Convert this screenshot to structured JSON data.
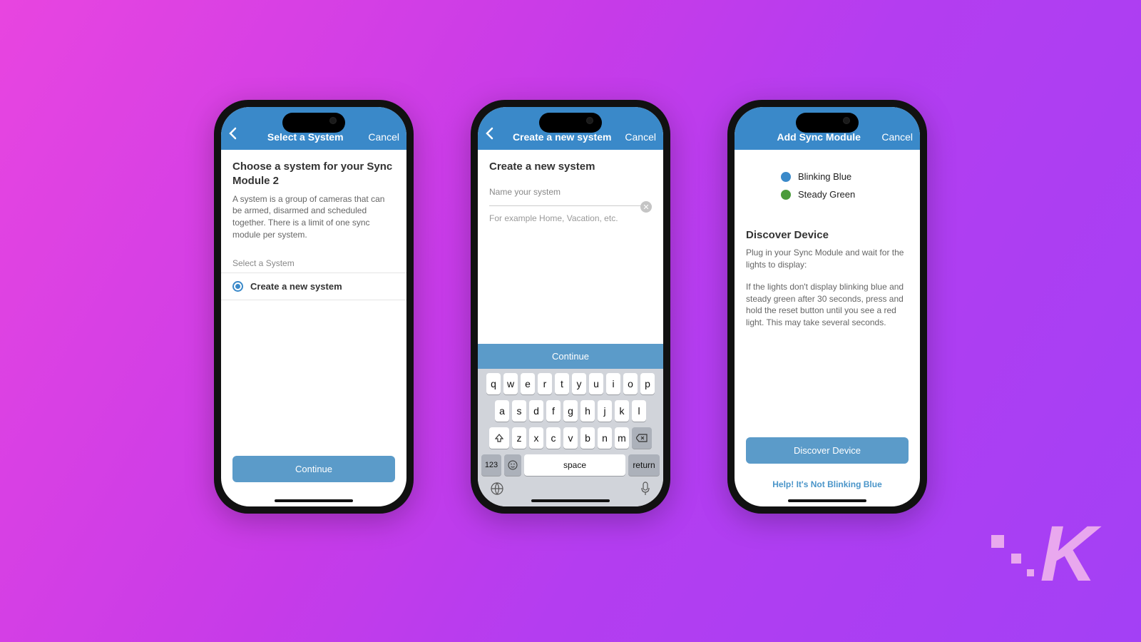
{
  "colors": {
    "header": "#3a89c9",
    "button": "#5b9bc9",
    "link": "#4a95c9"
  },
  "screen1": {
    "header_title": "Select a System",
    "cancel": "Cancel",
    "heading": "Choose a system for your Sync Module 2",
    "description": "A system is a group of cameras that can be armed, disarmed and scheduled together. There is a limit of one sync module per system.",
    "section_label": "Select a System",
    "option_label": "Create a new system",
    "continue": "Continue"
  },
  "screen2": {
    "header_title": "Create a new system",
    "cancel": "Cancel",
    "heading": "Create a new system",
    "input_label": "Name your system",
    "input_value": "",
    "hint": "For example Home, Vacation, etc.",
    "continue": "Continue",
    "keyboard": {
      "row1": [
        "q",
        "w",
        "e",
        "r",
        "t",
        "y",
        "u",
        "i",
        "o",
        "p"
      ],
      "row2": [
        "a",
        "s",
        "d",
        "f",
        "g",
        "h",
        "j",
        "k",
        "l"
      ],
      "row3": [
        "z",
        "x",
        "c",
        "v",
        "b",
        "n",
        "m"
      ],
      "num": "123",
      "space": "space",
      "return": "return"
    }
  },
  "screen3": {
    "header_title": "Add Sync Module",
    "cancel": "Cancel",
    "legend_blue": "Blinking Blue",
    "legend_green": "Steady Green",
    "heading": "Discover Device",
    "desc1": "Plug in your Sync Module and wait for the lights to display:",
    "desc2": "If the lights don't display blinking blue and steady green after 30 seconds, press and hold the reset button until you see a red light. This may take several seconds.",
    "button": "Discover Device",
    "help_link": "Help! It's Not Blinking Blue"
  },
  "logo_text": "K"
}
